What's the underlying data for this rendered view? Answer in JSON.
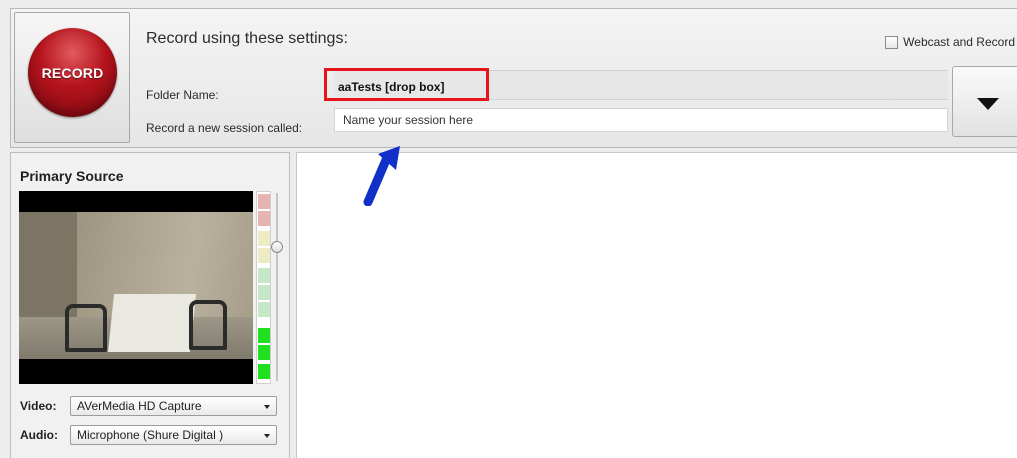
{
  "record": {
    "label": "RECORD"
  },
  "settings": {
    "title": "Record using these settings:",
    "webcast_label": "Webcast and Record",
    "webcast_checked": false,
    "folder_label": "Folder Name:",
    "folder_value": "aaTests [drop box]",
    "session_label": "Record a new session called:",
    "session_placeholder": "Name your session here"
  },
  "primary_source": {
    "title": "Primary Source",
    "video_label": "Video:",
    "video_value": "AVerMedia HD Capture",
    "audio_label": "Audio:",
    "audio_value": "Microphone (Shure Digital )"
  },
  "colors": {
    "record_red": "#b5141d",
    "highlight_red": "#e4141a",
    "annotation_blue": "#1030c8",
    "meter_green": "#1fe01f"
  }
}
